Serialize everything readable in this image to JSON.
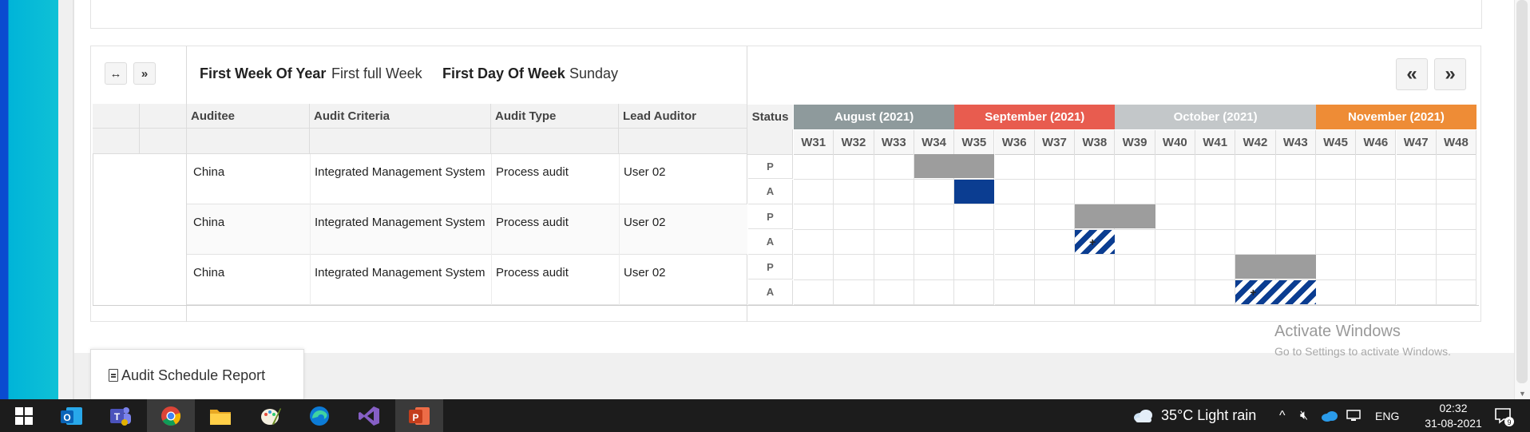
{
  "toolbar": {
    "left_btn1": "↔",
    "left_btn2": "»",
    "prev_btn": "«",
    "next_btn": "»"
  },
  "settings": {
    "first_week_label": "First Week Of Year",
    "first_week_value": "First full Week",
    "first_day_label": "First Day Of Week",
    "first_day_value": "Sunday"
  },
  "table": {
    "headers": [
      "Auditee",
      "Audit Criteria",
      "Audit Type",
      "Lead Auditor"
    ],
    "status_header": "Status",
    "rows": [
      {
        "auditee": "China",
        "criteria": "Integrated Management System",
        "type": "Process audit",
        "auditor": "User 02"
      },
      {
        "auditee": "China",
        "criteria": "Integrated Management System",
        "type": "Process audit",
        "auditor": "User 02"
      },
      {
        "auditee": "China",
        "criteria": "Integrated Management System",
        "type": "Process audit",
        "auditor": "User 02"
      }
    ]
  },
  "gantt": {
    "months": [
      {
        "label": "August (2021)",
        "color": "#8e9a9c"
      },
      {
        "label": "September (2021)",
        "color": "#e85c4f"
      },
      {
        "label": "October (2021)",
        "color": "#c3c7c9"
      },
      {
        "label": "November (2021)",
        "color": "#ee8c36"
      }
    ],
    "weeks": [
      "W31",
      "W32",
      "W33",
      "W34",
      "W35",
      "W36",
      "W37",
      "W38",
      "W39",
      "W40",
      "W41",
      "W42",
      "W43",
      "W45",
      "W46",
      "W47",
      "W48"
    ],
    "status_labels": [
      "P",
      "A",
      "P",
      "A",
      "P",
      "A"
    ],
    "plan_color": "#9d9d9d",
    "actual_color": "#0b3d91"
  },
  "popup": {
    "label": "Audit Schedule Report"
  },
  "watermark": {
    "line1": "Activate Windows",
    "line2": "Go to Settings to activate Windows."
  },
  "taskbar": {
    "weather": "35°C  Light rain",
    "lang": "ENG",
    "time": "02:32",
    "date": "31-08-2021",
    "notifications": "9"
  }
}
